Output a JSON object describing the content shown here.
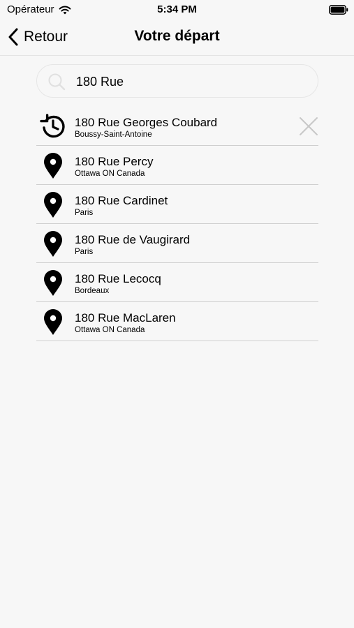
{
  "status_bar": {
    "carrier": "Opérateur",
    "time": "5:34 PM"
  },
  "nav": {
    "back_label": "Retour",
    "title": "Votre départ"
  },
  "search": {
    "value": "180 Rue",
    "icon": "magnifier"
  },
  "results": [
    {
      "title": "180 Rue Georges Coubard",
      "subtitle": "Boussy-Saint-Antoine",
      "icon": "history",
      "deletable": true
    },
    {
      "title": "180 Rue Percy",
      "subtitle": "Ottawa ON Canada",
      "icon": "map-pin"
    },
    {
      "title": "180 Rue Cardinet",
      "subtitle": "Paris",
      "icon": "map-pin"
    },
    {
      "title": "180 Rue de Vaugirard",
      "subtitle": "Paris",
      "icon": "map-pin"
    },
    {
      "title": "180 Rue Lecocq",
      "subtitle": "Bordeaux",
      "icon": "map-pin"
    },
    {
      "title": "180 Rue MacLaren",
      "subtitle": "Ottawa ON Canada",
      "icon": "map-pin"
    }
  ],
  "colors": {
    "background": "#f7f7f7",
    "separator": "#cfcfcf",
    "text": "#000000",
    "delete_icon": "#c8c8c8"
  }
}
